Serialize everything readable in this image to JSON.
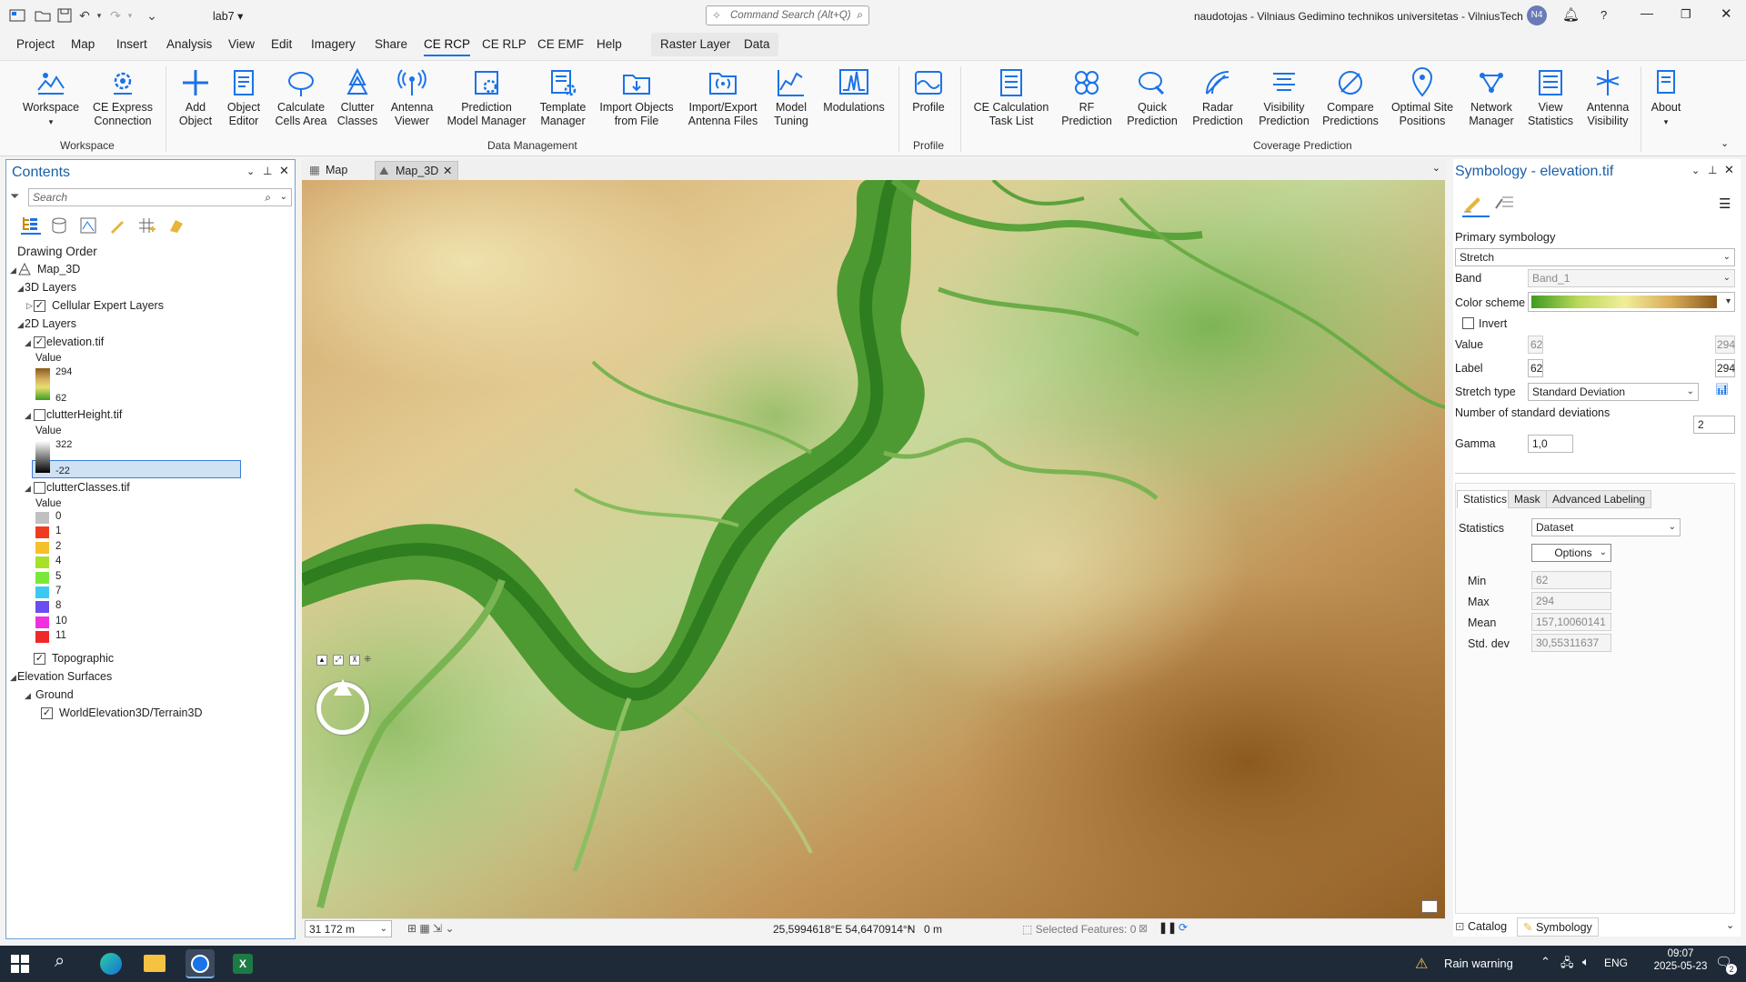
{
  "titlebar": {
    "project_name": "lab7",
    "command_search_placeholder": "Command Search (Alt+Q)",
    "user_info": "naudotojas - Vilniaus Gedimino technikos universitetas - VilniusTech",
    "user_initials": "N4",
    "help": "?"
  },
  "menu": [
    "Project",
    "Map",
    "Insert",
    "Analysis",
    "View",
    "Edit",
    "Imagery",
    "Share",
    "CE RCP",
    "CE RLP",
    "CE EMF",
    "Help"
  ],
  "menu_active": "CE RCP",
  "context_tabs": [
    "Raster Layer",
    "Data"
  ],
  "ribbon": {
    "buttons": [
      {
        "label1": "Workspace",
        "label2": "",
        "icon": "workspace-icon"
      },
      {
        "label1": "CE Express",
        "label2": "Connection",
        "icon": "gear-cloud-icon"
      },
      {
        "label1": "Add",
        "label2": "Object",
        "icon": "plus-icon"
      },
      {
        "label1": "Object",
        "label2": "Editor",
        "icon": "object-editor-icon"
      },
      {
        "label1": "Calculate",
        "label2": "Cells Area",
        "icon": "cells-area-icon"
      },
      {
        "label1": "Clutter",
        "label2": "Classes",
        "icon": "clutter-icon"
      },
      {
        "label1": "Antenna",
        "label2": "Viewer",
        "icon": "antenna-icon"
      },
      {
        "label1": "Prediction",
        "label2": "Model Manager",
        "icon": "prediction-model-icon"
      },
      {
        "label1": "Template",
        "label2": "Manager",
        "icon": "template-icon"
      },
      {
        "label1": "Import Objects",
        "label2": "from File",
        "icon": "folder-import-icon"
      },
      {
        "label1": "Import/Export",
        "label2": "Antenna Files",
        "icon": "antenna-files-icon"
      },
      {
        "label1": "Model",
        "label2": "Tuning",
        "icon": "model-tuning-icon"
      },
      {
        "label1": "Modulations",
        "label2": "",
        "icon": "modulations-icon"
      },
      {
        "label1": "Profile",
        "label2": "",
        "icon": "profile-icon"
      },
      {
        "label1": "CE Calculation",
        "label2": "Task List",
        "icon": "task-list-icon"
      },
      {
        "label1": "RF",
        "label2": "Prediction",
        "icon": "rf-prediction-icon"
      },
      {
        "label1": "Quick",
        "label2": "Prediction",
        "icon": "quick-prediction-icon"
      },
      {
        "label1": "Radar",
        "label2": "Prediction",
        "icon": "radar-icon"
      },
      {
        "label1": "Visibility",
        "label2": "Prediction",
        "icon": "visibility-icon"
      },
      {
        "label1": "Compare",
        "label2": "Predictions",
        "icon": "compare-icon"
      },
      {
        "label1": "Optimal Site",
        "label2": "Positions",
        "icon": "site-position-icon"
      },
      {
        "label1": "Network",
        "label2": "Manager",
        "icon": "network-icon"
      },
      {
        "label1": "View",
        "label2": "Statistics",
        "icon": "statistics-icon"
      },
      {
        "label1": "Antenna",
        "label2": "Visibility",
        "icon": "antenna-visibility-icon"
      },
      {
        "label1": "About",
        "label2": "",
        "icon": "about-icon"
      }
    ],
    "groups": [
      "Workspace",
      "Data Management",
      "Profile",
      "Coverage Prediction"
    ]
  },
  "contents": {
    "title": "Contents",
    "search_placeholder": "Search",
    "drawing_order": "Drawing Order",
    "map_name": "Map_3D",
    "layers_3d": "3D Layers",
    "cellular_layers": "Cellular Expert Layers",
    "layers_2d": "2D Layers",
    "elevation": {
      "name": "elevation.tif",
      "value_label": "Value",
      "max": "294",
      "min": "62"
    },
    "clutter_height": {
      "name": "clutterHeight.tif",
      "value_label": "Value",
      "max": "322",
      "min": "-22"
    },
    "clutter_classes": {
      "name": "clutterClasses.tif",
      "value_label": "Value",
      "classes": [
        {
          "label": "0",
          "color": "#c0c0c0"
        },
        {
          "label": "1",
          "color": "#f03c1e"
        },
        {
          "label": "2",
          "color": "#f5c02a"
        },
        {
          "label": "4",
          "color": "#a8e02a"
        },
        {
          "label": "5",
          "color": "#7ae83a"
        },
        {
          "label": "7",
          "color": "#3cc8f0"
        },
        {
          "label": "8",
          "color": "#6a4cf0"
        },
        {
          "label": "10",
          "color": "#f030e0"
        },
        {
          "label": "11",
          "color": "#f02828"
        }
      ]
    },
    "topographic": "Topographic",
    "elevation_surfaces": "Elevation Surfaces",
    "ground": "Ground",
    "world_elevation": "WorldElevation3D/Terrain3D"
  },
  "doc_tabs": [
    "Map",
    "Map_3D"
  ],
  "status": {
    "scale": "31 172 m",
    "coords": "25,5994618°E 54,6470914°N",
    "elev": "0 m",
    "selected": "Selected Features: 0"
  },
  "symbology": {
    "title": "Symbology - elevation.tif",
    "primary": "Primary symbology",
    "renderer": "Stretch",
    "band_label": "Band",
    "band_value": "Band_1",
    "color_scheme_label": "Color scheme",
    "invert_label": "Invert",
    "value_label": "Value",
    "value_min": "62",
    "value_max": "294",
    "label_label": "Label",
    "label_min": "62",
    "label_max": "294",
    "stretch_type_label": "Stretch type",
    "stretch_type": "Standard Deviation",
    "num_std_label": "Number of standard deviations",
    "num_std": "2",
    "gamma_label": "Gamma",
    "gamma": "1,0",
    "tabs": [
      "Statistics",
      "Mask",
      "Advanced Labeling"
    ],
    "statistics_label": "Statistics",
    "statistics_value": "Dataset",
    "options_label": "Options",
    "stats": [
      {
        "label": "Min",
        "value": "62"
      },
      {
        "label": "Max",
        "value": "294"
      },
      {
        "label": "Mean",
        "value": "157,10060141"
      },
      {
        "label": "Std. dev",
        "value": "30,55311637"
      }
    ],
    "bottom_tabs": [
      "Catalog",
      "Symbology"
    ]
  },
  "taskbar": {
    "weather": "Rain warning",
    "lang": "ENG",
    "time": "09:07",
    "date": "2025-05-23",
    "notif_count": "2"
  },
  "colors": {
    "accent": "#1a73e8",
    "ribbon_icon": "#1a73e8",
    "green_low": "#2e7d1e",
    "brown_high": "#8a5a1c"
  }
}
